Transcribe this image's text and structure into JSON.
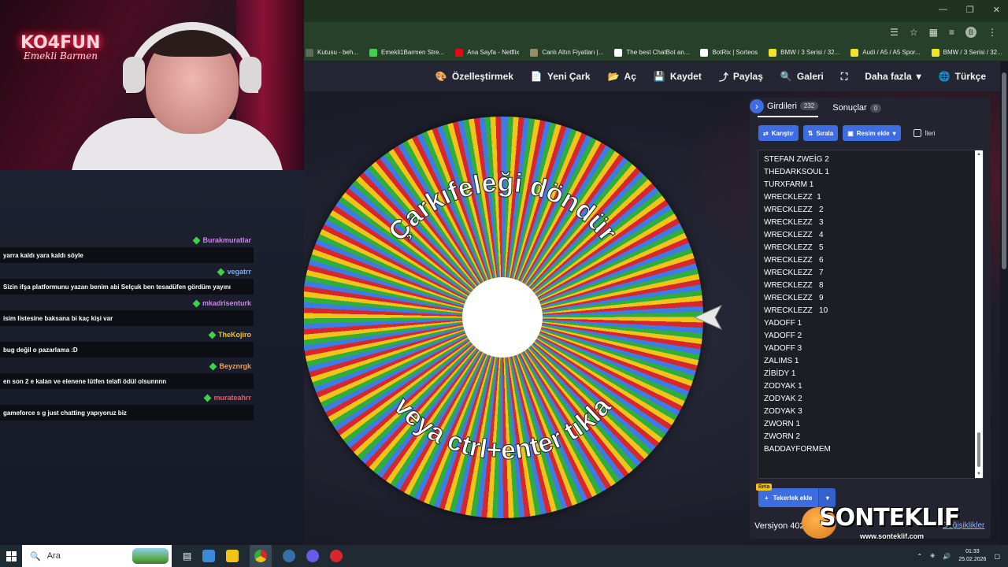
{
  "browser": {
    "bookmarks": [
      {
        "label": "Kutusu - beh...",
        "color": "#5a6d5a"
      },
      {
        "label": "Emekli1Barmen Stre...",
        "color": "#3fd14a"
      },
      {
        "label": "Ana Sayfa - Netflix",
        "color": "#e50914"
      },
      {
        "label": "Canlı Altın Fiyatları |...",
        "color": "#9a8a6a"
      },
      {
        "label": "The best ChatBot an...",
        "color": "#ffffff"
      },
      {
        "label": "BotRix | Sorteos",
        "color": "#ffffff"
      },
      {
        "label": "BMW / 3 Serisi / 32...",
        "color": "#f5e02a"
      },
      {
        "label": "Audi / A5 / A5 Spor...",
        "color": "#f5e02a"
      },
      {
        "label": "BMW / 3 Serisi / 32...",
        "color": "#f5e02a"
      }
    ],
    "profile_initial": "B"
  },
  "nav": {
    "customize": "Özelleştirmek",
    "new_wheel": "Yeni Çark",
    "open": "Aç",
    "save": "Kaydet",
    "share": "Paylaş",
    "gallery": "Galeri",
    "more": "Daha fazla",
    "language": "Türkçe"
  },
  "wheel": {
    "top_text": "Çarkıfeleği döndür",
    "bottom_text": "veya ctrl+enter tıkla",
    "colors": [
      "#3f7be6",
      "#2fae3c",
      "#f2c318",
      "#d8262f"
    ]
  },
  "panel": {
    "tab_entries": "Girdileri",
    "entries_count": "232",
    "tab_results": "Sonuçlar",
    "results_count": "0",
    "shuffle": "Karıştır",
    "sort": "Sırala",
    "add_image": "Resim ekle",
    "advanced": "İleri",
    "entries": [
      "STEFAN ZWEİG 2",
      "THEDARKSOUL 1",
      "TURXFARM 1",
      "WRECKLEZZ  1",
      "WRECKLEZZ   2",
      "WRECKLEZZ   3",
      "WRECKLEZZ   4",
      "WRECKLEZZ   5",
      "WRECKLEZZ   6",
      "WRECKLEZZ   7",
      "WRECKLEZZ   8",
      "WRECKLEZZ   9",
      "WRECKLEZZ   10",
      "YADOFF 1",
      "YADOFF 2",
      "YADOFF 3",
      "ZALIMS 1",
      "ZİBİDY 1",
      "ZODYAK 1",
      "ZODYAK 2",
      "ZODYAK 3",
      "ZWORN 1",
      "ZWORN 2",
      "BADDAYFORMEM"
    ],
    "beta": "Beta",
    "add_wheel": "Tekerlek ekle",
    "version": "Versiyon 402",
    "changes": "Değişiklikler"
  },
  "stream": {
    "neon_title": "KO4FUN",
    "neon_subtitle": "Emekli Barmen",
    "chat": [
      {
        "user": "Burakmuratlar",
        "color": "#d67cff",
        "text": "yarra kaldı yara kaldı söyle"
      },
      {
        "user": "vegatrr",
        "color": "#7aa8ff",
        "text": "Sizin ifşa platformunu yazan benim abi Selçuk ben tesadüfen gördüm yayını"
      },
      {
        "user": "mkadrisenturk",
        "color": "#d67cff",
        "text": "isim listesine baksana bi kaç kişi var"
      },
      {
        "user": "TheKojiro",
        "color": "#f2c318",
        "text": "bug değil o pazarlama :D"
      },
      {
        "user": "Beyznrgk",
        "color": "#ff9a3a",
        "text": "en son 2 e kalan ve elenene lütfen telafi ödül olsunnnn"
      },
      {
        "user": "murateahrr",
        "color": "#ff4a6a",
        "text": "gameforce s g just chatting yapıyoruz biz"
      }
    ]
  },
  "taskbar": {
    "search_placeholder": "Ara",
    "time": "01:33",
    "date": "25.02.2026"
  },
  "watermark": {
    "brand": "SONTEKLIF",
    "url": "www.sonteklif.com"
  }
}
